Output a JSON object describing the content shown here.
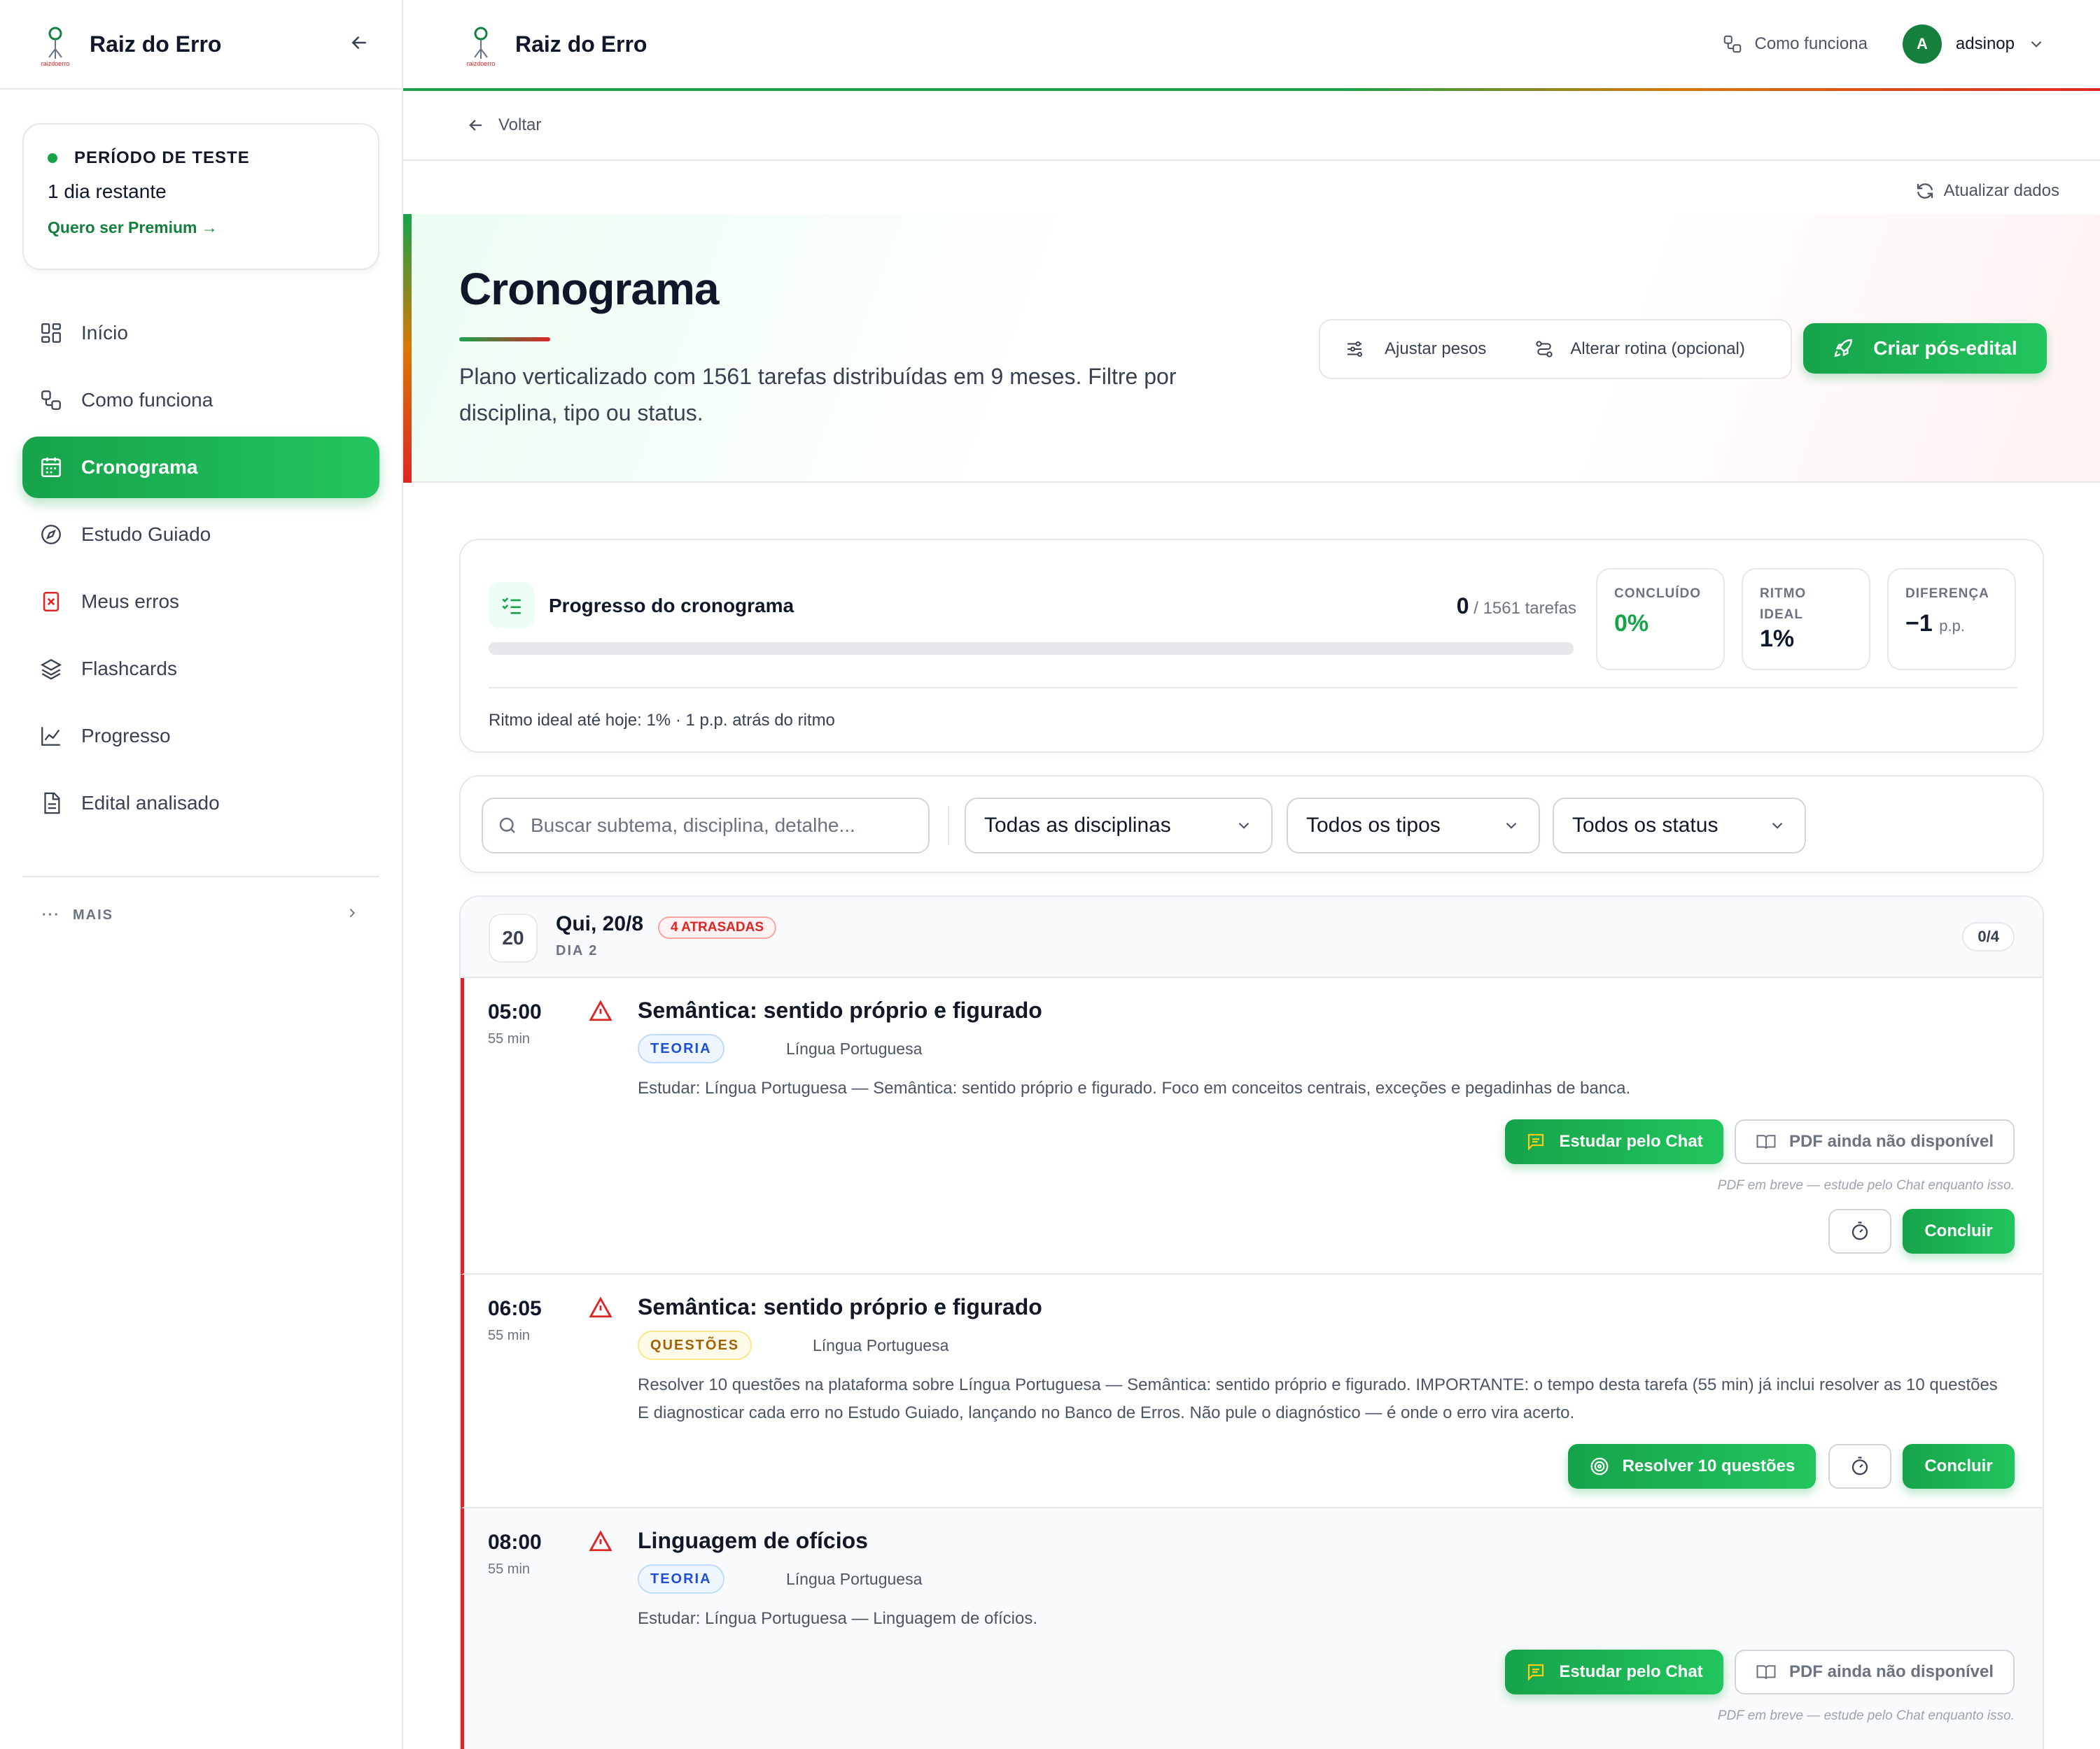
{
  "app": {
    "brand": "Raiz do Erro",
    "logo_text": "raizdoerro"
  },
  "sidebar": {
    "trial_label": "PERÍODO DE TESTE",
    "trial_remaining": "1 dia restante",
    "premium_link": "Quero ser Premium →",
    "items": [
      {
        "label": "Início",
        "icon": "grid-icon"
      },
      {
        "label": "Como funciona",
        "icon": "workflow-icon"
      },
      {
        "label": "Cronograma",
        "icon": "calendar-icon",
        "active": true
      },
      {
        "label": "Estudo Guiado",
        "icon": "compass-icon"
      },
      {
        "label": "Meus erros",
        "icon": "error-square-icon"
      },
      {
        "label": "Flashcards",
        "icon": "layers-icon"
      },
      {
        "label": "Progresso",
        "icon": "chart-line-icon"
      },
      {
        "label": "Edital analisado",
        "icon": "document-icon"
      }
    ],
    "more_label": "MAIS"
  },
  "header": {
    "how_label": "Como funciona",
    "avatar_initial": "A",
    "username": "adsinop"
  },
  "back_label": "Voltar",
  "refresh_label": "Atualizar dados",
  "hero": {
    "title": "Cronograma",
    "description": "Plano verticalizado com 1561 tarefas distribuídas em 9 meses. Filtre por disciplina, tipo ou status.",
    "adjust_label": "Ajustar pesos",
    "routine_label": "Alterar rotina (opcional)",
    "create_label": "Criar pós-edital"
  },
  "progress": {
    "title": "Progresso do cronograma",
    "done": "0",
    "total": "/ 1561 tarefas",
    "fraction": 0,
    "concluido_label": "CONCLUÍDO",
    "concluido_value": "0%",
    "ritmo_label": "RITMO IDEAL",
    "ritmo_value": "1%",
    "diff_label": "DIFERENÇA",
    "diff_value": "−1",
    "diff_unit": "p.p.",
    "footer": "Ritmo ideal até hoje: 1% · 1 p.p. atrás do ritmo"
  },
  "filters": {
    "search_placeholder": "Buscar subtema, disciplina, detalhe...",
    "discipline": "Todas as disciplinas",
    "type": "Todos os tipos",
    "status": "Todos os status"
  },
  "day": {
    "number": "20",
    "title": "Qui, 20/8",
    "late_badge": "4 ATRASADAS",
    "subtitle": "DIA 2",
    "count": "0/4"
  },
  "tasks": [
    {
      "time": "05:00",
      "duration": "55 min",
      "title": "Semântica: sentido próprio e figurado",
      "tag": "TEORIA",
      "discipline": "Língua Portuguesa",
      "description": "Estudar: Língua Portuguesa — Semântica: sentido próprio e figurado. Foco em conceitos centrais, exceções e pegadinhas de banca.",
      "chat_label": "Estudar pelo Chat",
      "pdf_label": "PDF ainda não disponível",
      "note": "PDF em breve — estude pelo Chat enquanto isso.",
      "conclude_label": "Concluir"
    },
    {
      "time": "06:05",
      "duration": "55 min",
      "title": "Semântica: sentido próprio e figurado",
      "tag": "QUESTÕES",
      "discipline": "Língua Portuguesa",
      "description": "Resolver 10 questões na plataforma sobre Língua Portuguesa — Semântica: sentido próprio e figurado. IMPORTANTE: o tempo desta tarefa (55 min) já inclui resolver as 10 questões E diagnosticar cada erro no Estudo Guiado, lançando no Banco de Erros. Não pule o diagnóstico — é onde o erro vira acerto.",
      "resolve_label": "Resolver 10 questões",
      "conclude_label": "Concluir"
    },
    {
      "time": "08:00",
      "duration": "55 min",
      "title": "Linguagem de ofícios",
      "tag": "TEORIA",
      "discipline": "Língua Portuguesa",
      "description": "Estudar: Língua Portuguesa — Linguagem de ofícios.",
      "chat_label": "Estudar pelo Chat",
      "pdf_label": "PDF ainda não disponível",
      "note": "PDF em breve — estude pelo Chat enquanto isso."
    }
  ],
  "colors": {
    "accent": "#16a34a",
    "danger": "#dc2626",
    "warning": "#d97706"
  }
}
